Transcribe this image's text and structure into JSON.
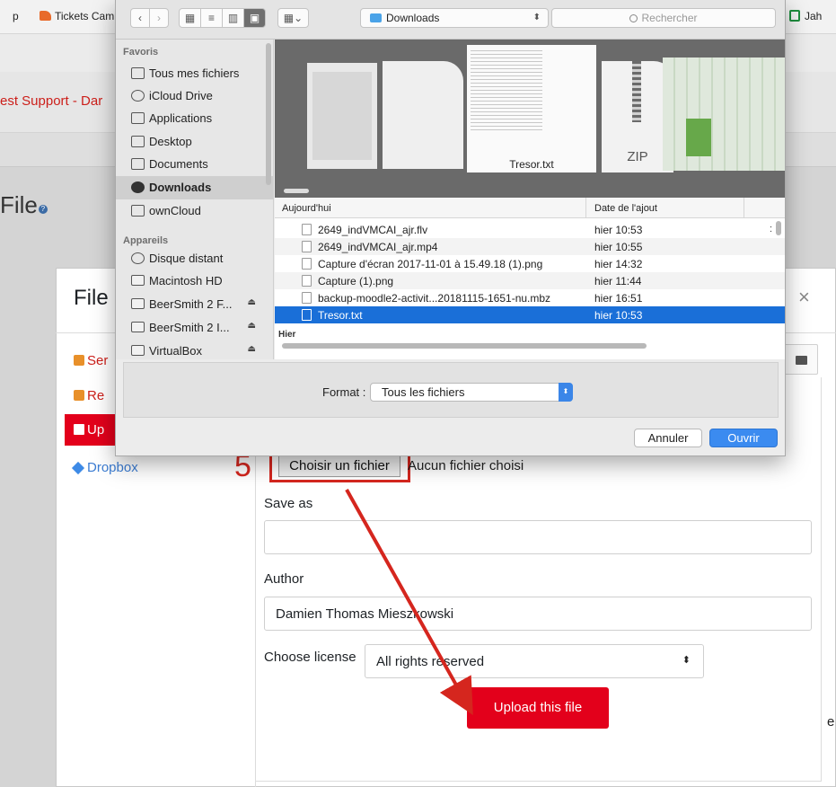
{
  "browser": {
    "bookmark_left": "p",
    "bookmark_tickets": "Tickets Cam",
    "bookmark_right": "Jah"
  },
  "page": {
    "breadcrumb": "est Support - Dar",
    "title": "File"
  },
  "moodle_picker": {
    "title": "File",
    "close": "×",
    "repositories": [
      "Ser",
      "Re",
      "Up",
      "Dropbox"
    ],
    "step_number": "5",
    "choose_file_button": "Choisir un fichier",
    "no_file_text": "Aucun fichier choisi",
    "save_as_label": "Save as",
    "save_as_value": "",
    "author_label": "Author",
    "author_value": "Damien Thomas Mieszkowski",
    "license_label": "Choose license",
    "license_value": "All rights reserved",
    "upload_button": "Upload this file",
    "edge_letter": "e"
  },
  "mac_dialog": {
    "location": "Downloads",
    "search_placeholder": "Rechercher",
    "sidebar": {
      "favorites_header": "Favoris",
      "favorites": [
        "Tous mes fichiers",
        "iCloud Drive",
        "Applications",
        "Desktop",
        "Documents",
        "Downloads",
        "ownCloud"
      ],
      "selected": "Downloads",
      "devices_header": "Appareils",
      "devices": [
        "Disque distant",
        "Macintosh HD",
        "BeerSmith 2 F...",
        "BeerSmith 2 I...",
        "VirtualBox"
      ]
    },
    "preview": {
      "selected_file_label": "Tresor.txt",
      "zip_label": "ZIP"
    },
    "list": {
      "col_name": "Aujourd'hui",
      "col_date": "Date de l'ajout",
      "rows": [
        {
          "name": "2649_indVMCAI_ajr.flv",
          "date": "hier 10:53"
        },
        {
          "name": "2649_indVMCAI_ajr.mp4",
          "date": "hier 10:55"
        },
        {
          "name": "Capture d'écran 2017-11-01 à 15.49.18 (1).png",
          "date": "hier 14:32"
        },
        {
          "name": "Capture (1).png",
          "date": "hier 11:44"
        },
        {
          "name": "backup-moodle2-activit...20181115-1651-nu.mbz",
          "date": "hier 16:51"
        },
        {
          "name": "Tresor.txt",
          "date": "hier 10:53"
        }
      ],
      "selected_row": "Tresor.txt",
      "group2": "Hier"
    },
    "format_label": "Format :",
    "format_value": "Tous les fichiers",
    "cancel_button": "Annuler",
    "open_button": "Ouvrir"
  },
  "colors": {
    "moodle_red": "#e3001b",
    "annotation_red": "#d5261e",
    "mac_selection_blue": "#1a6fd8",
    "dropbox_blue": "#3c7dd3"
  }
}
